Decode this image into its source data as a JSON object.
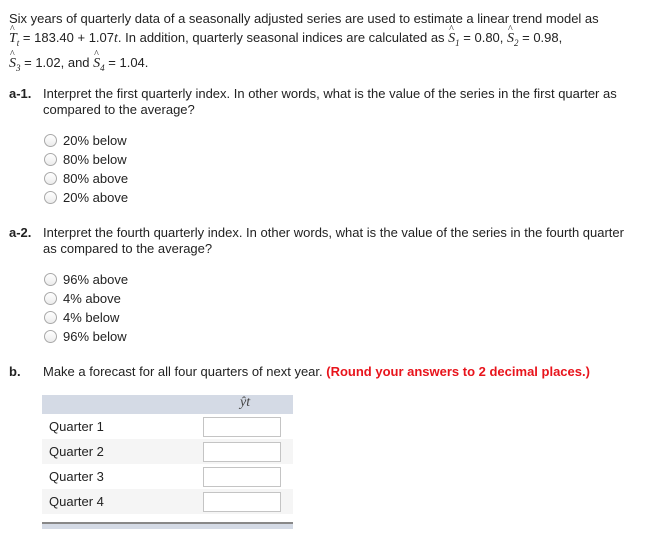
{
  "intro": {
    "line1": "Six years of quarterly data of a seasonally adjusted series are used to estimate a linear trend model as",
    "trend_symbol": "T",
    "trend_sub": "t",
    "trend_eq": " = 183.40 + 1.07",
    "trend_var": "t",
    "mid_text": ". In addition, quarterly seasonal indices are calculated as ",
    "s_symbol": "S",
    "s1_sub": "1",
    "s1_val": " = 0.80, ",
    "s2_sub": "2",
    "s2_val": " = 0.98,",
    "s3_sub": "3",
    "s3_val": " = 1.02, and ",
    "s4_sub": "4",
    "s4_val": " = 1.04."
  },
  "questions": [
    {
      "number": "a-1.",
      "text": "Interpret the first quarterly index. In other words, what is the value of the series in the first quarter as compared to the average?",
      "options": [
        "20% below",
        "80% below",
        "80% above",
        "20% above"
      ]
    },
    {
      "number": "a-2.",
      "text": "Interpret the fourth quarterly index. In other words, what is the value of the series in the fourth quarter as compared to the average?",
      "options": [
        "96% above",
        "4% above",
        "4% below",
        "96% below"
      ]
    }
  ],
  "part_b": {
    "number": "b.",
    "text": "Make a forecast for all four quarters of next year. ",
    "instruction": "(Round your answers to 2 decimal places.)",
    "table": {
      "column_header": "ŷt",
      "rows": [
        {
          "label": "Quarter 1",
          "value": ""
        },
        {
          "label": "Quarter 2",
          "value": ""
        },
        {
          "label": "Quarter 3",
          "value": ""
        },
        {
          "label": "Quarter 4",
          "value": ""
        }
      ]
    }
  },
  "colors": {
    "instruction": "#e8141c",
    "table_header": "#d4dae5",
    "row_alt": "#f5f5f5"
  }
}
